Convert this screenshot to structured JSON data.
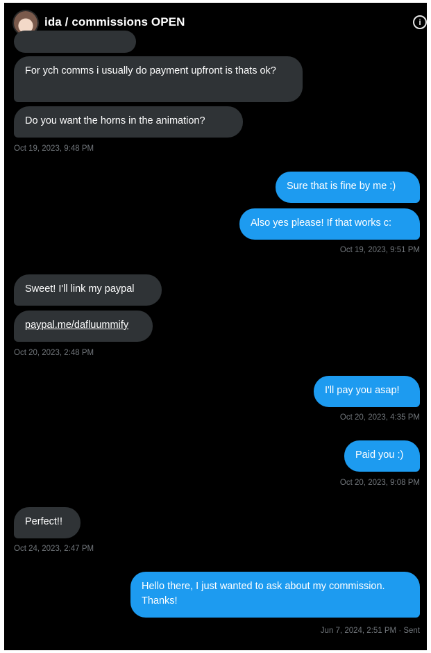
{
  "header": {
    "title": "ida / commissions OPEN",
    "avatar": "avatar",
    "info_icon": "info-icon",
    "info_glyph": "i"
  },
  "colors": {
    "background": "#000000",
    "received_bubble": "#2f3336",
    "sent_bubble": "#1d9bf0",
    "timestamp": "#71767b"
  },
  "messages": [
    {
      "id": "m1",
      "from": "them",
      "text": "For ych comms i usually do payment upfront is thats ok?"
    },
    {
      "id": "m2",
      "from": "them",
      "text": "Do you want the horns in the animation?"
    },
    {
      "id": "t1",
      "timestamp": "Oct 19, 2023, 9:48 PM"
    },
    {
      "id": "m3",
      "from": "me",
      "text": "Sure that is fine by me :)"
    },
    {
      "id": "m4",
      "from": "me",
      "text": "Also yes please! If that works c:"
    },
    {
      "id": "t2",
      "timestamp": "Oct 19, 2023, 9:51 PM"
    },
    {
      "id": "m5",
      "from": "them",
      "text": "Sweet! I'll link my paypal"
    },
    {
      "id": "m6",
      "from": "them",
      "text": "paypal.me/dafluummify",
      "is_link": true
    },
    {
      "id": "t3",
      "timestamp": "Oct 20, 2023, 2:48 PM"
    },
    {
      "id": "m7",
      "from": "me",
      "text": "I'll pay you asap!"
    },
    {
      "id": "t4",
      "timestamp": "Oct 20, 2023, 4:35 PM"
    },
    {
      "id": "m8",
      "from": "me",
      "text": "Paid you :)"
    },
    {
      "id": "t5",
      "timestamp": "Oct 20, 2023, 9:08 PM"
    },
    {
      "id": "m9",
      "from": "them",
      "text": "Perfect!!"
    },
    {
      "id": "t6",
      "timestamp": "Oct 24, 2023, 2:47 PM"
    },
    {
      "id": "m10",
      "from": "me",
      "text": "Hello there, I just wanted to ask about my commission. Thanks!"
    },
    {
      "id": "t7",
      "timestamp": "Jun 7, 2024, 2:51 PM · Sent"
    }
  ]
}
